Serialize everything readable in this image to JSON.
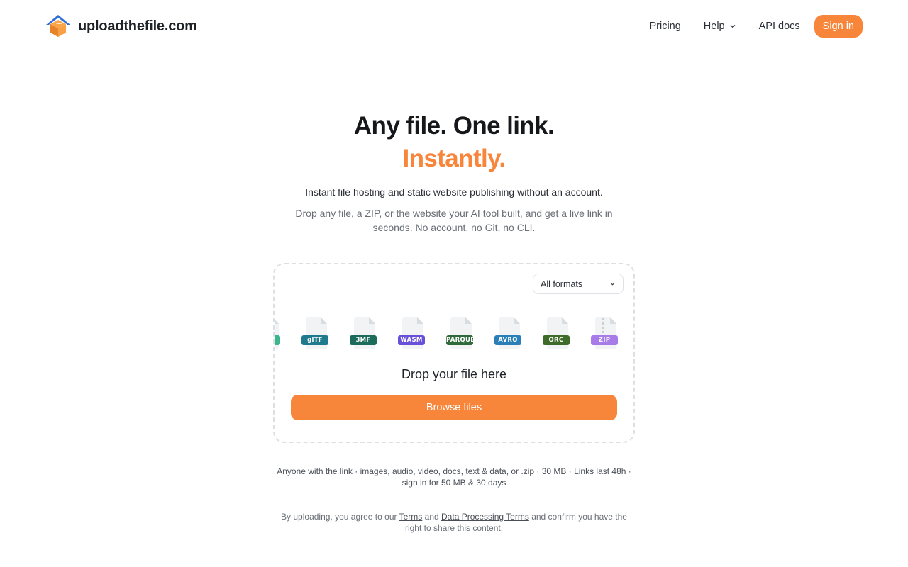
{
  "header": {
    "logo_text": "uploadthefile.com",
    "nav": {
      "pricing": "Pricing",
      "help": "Help",
      "api_docs": "API docs",
      "sign_in": "Sign in"
    }
  },
  "hero": {
    "title": "Any file. One link.",
    "accent": "Instantly.",
    "lead": "Instant file hosting and static website publishing without an account.",
    "sub": "Drop any file, a ZIP, or the website your AI tool built, and get a live link in seconds. No account, no Git, no CLI."
  },
  "dropzone": {
    "format_select": "All formats",
    "file_types": [
      {
        "label": "glTF",
        "color": "#1e7a8c"
      },
      {
        "label": "3MF",
        "color": "#1d6b5a"
      },
      {
        "label": "WASM",
        "color": "#6a4fd8"
      },
      {
        "label": "PARQUET",
        "color": "#2f6b3a"
      },
      {
        "label": "AVRO",
        "color": "#2a7fb8"
      },
      {
        "label": "ORC",
        "color": "#3e6b2a"
      },
      {
        "label": "ZIP",
        "color": "#a77be8"
      }
    ],
    "drop_label": "Drop your file here",
    "browse_label": "Browse files"
  },
  "info": {
    "limits": "Anyone with the link · images, audio, video, docs, text & data, or .zip · 30 MB · Links last 48h · sign in for 50 MB & 30 days"
  },
  "legal": {
    "prefix": "By uploading, you agree to our",
    "terms": "Terms",
    "and": "and",
    "dpt": "Data Processing Terms",
    "suffix": "and confirm you have the right to share this content."
  },
  "colors": {
    "accent": "#f7853a"
  }
}
